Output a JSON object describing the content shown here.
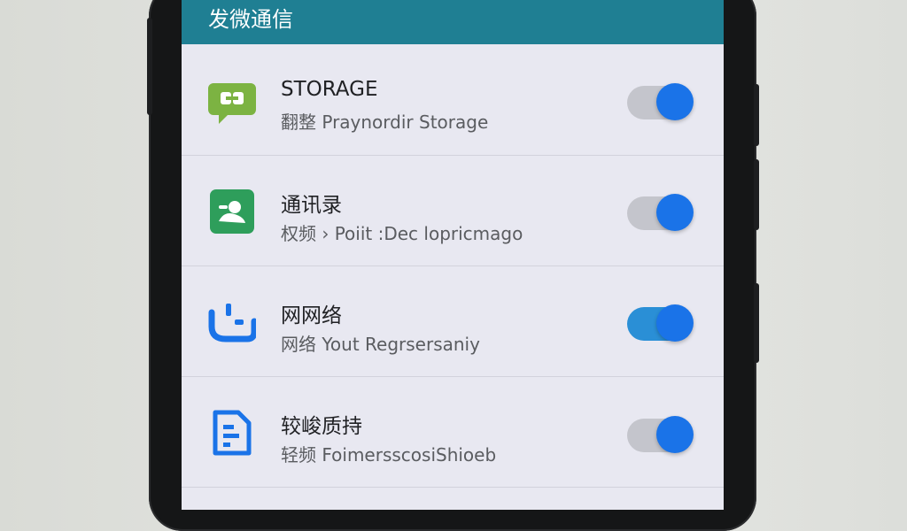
{
  "header": {
    "title": "发微通信"
  },
  "rows": [
    {
      "title": "STORAGE",
      "subtitle": "翻整 Praynordir Storage",
      "icon": "chat-icon",
      "toggle_on": true,
      "track_color": "#c4c5cc",
      "accent": "#7cb342"
    },
    {
      "title": "通讯录",
      "subtitle": "权频 › Poiit :Dec lopricmago",
      "icon": "contacts-icon",
      "toggle_on": true,
      "track_color": "#c4c5cc",
      "accent": "#2e9e5b"
    },
    {
      "title": "网网络",
      "subtitle": "网络 Yout Regrsersaniy",
      "icon": "network-icon",
      "toggle_on": true,
      "track_color": "#2a8fd6",
      "accent": "#1a73e8"
    },
    {
      "title": "较峻质持",
      "subtitle": "轻频 FoimersscosiShioeb",
      "icon": "document-icon",
      "toggle_on": true,
      "track_color": "#c4c5cc",
      "accent": "#1a73e8"
    }
  ]
}
